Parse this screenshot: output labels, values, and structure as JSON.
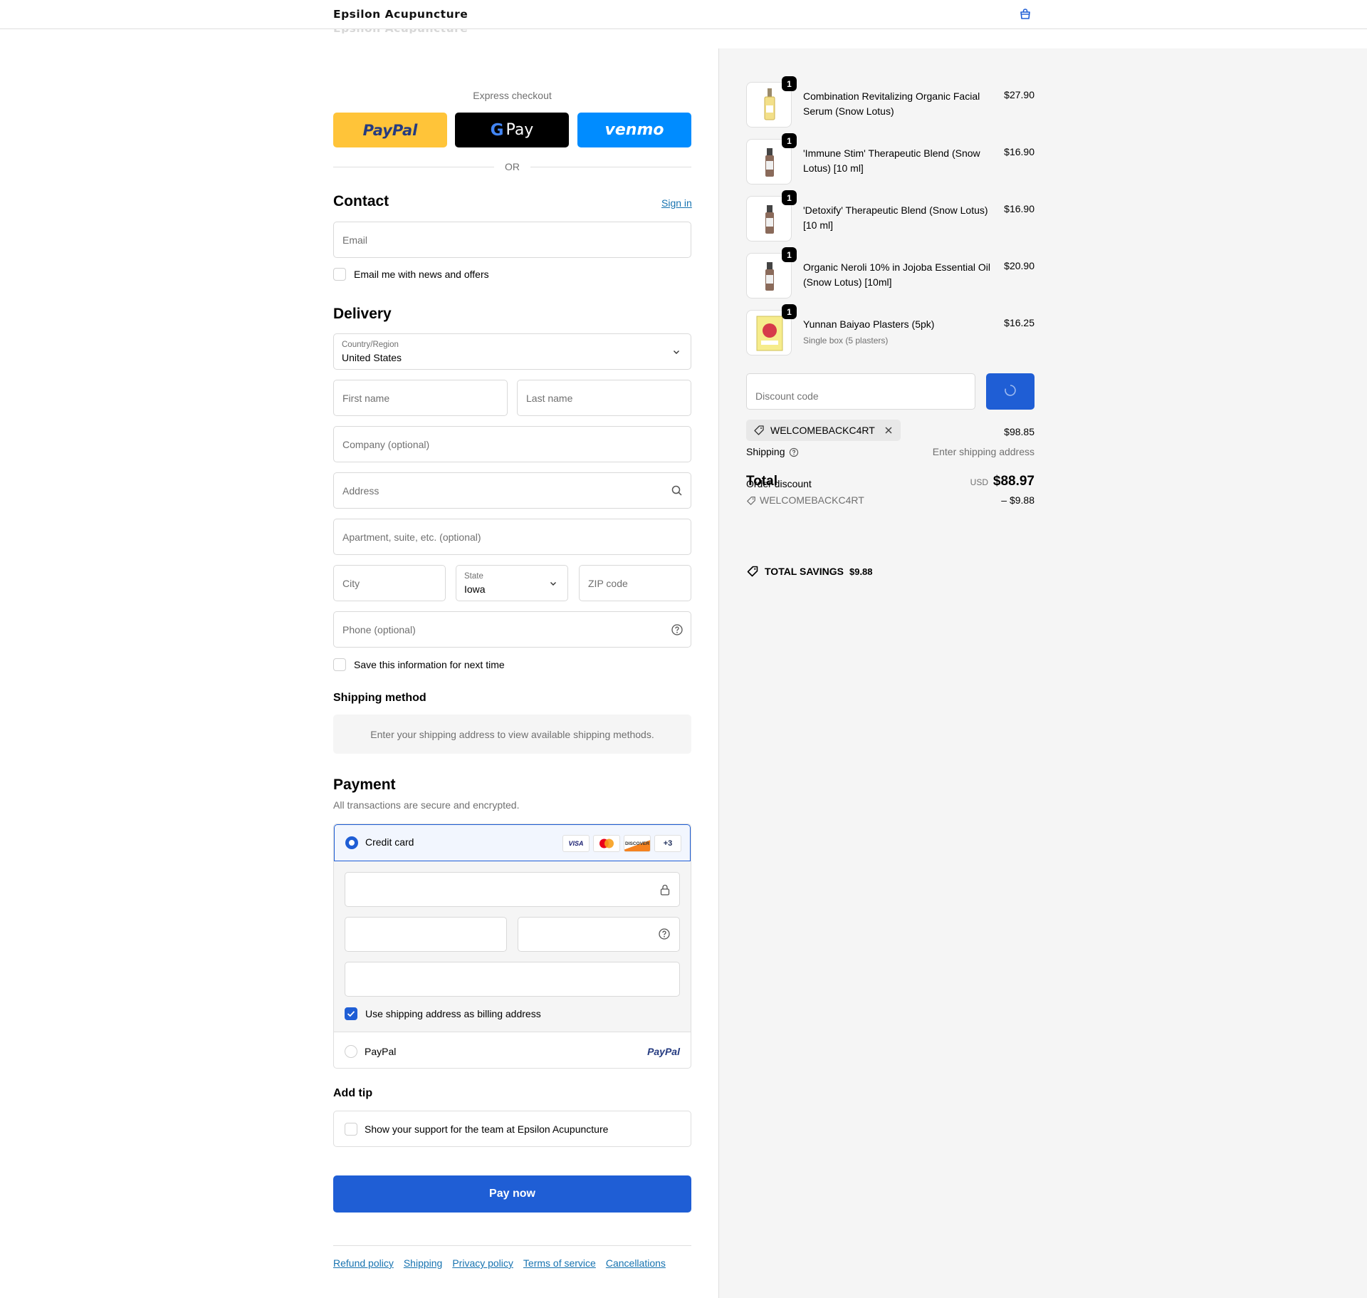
{
  "header": {
    "brand": "Epsilon Acupuncture"
  },
  "express": {
    "label": "Express checkout",
    "paypal": "PayPal",
    "gpay_g": "G",
    "gpay": "Pay",
    "venmo": "venmo",
    "or": "OR"
  },
  "contact": {
    "title": "Contact",
    "sign_in": "Sign in",
    "email_placeholder": "Email",
    "news_label": "Email me with news and offers"
  },
  "delivery": {
    "title": "Delivery",
    "country_label": "Country/Region",
    "country_value": "United States",
    "first_name": "First name",
    "last_name": "Last name",
    "company": "Company (optional)",
    "address": "Address",
    "apartment": "Apartment, suite, etc. (optional)",
    "city": "City",
    "state_label": "State",
    "state_value": "Iowa",
    "zip": "ZIP code",
    "phone": "Phone (optional)",
    "save_label": "Save this information for next time"
  },
  "shipping_method": {
    "title": "Shipping method",
    "info": "Enter your shipping address to view available shipping methods."
  },
  "payment": {
    "title": "Payment",
    "subtitle": "All transactions are secure and encrypted.",
    "credit_card": "Credit card",
    "cards": [
      "VISA",
      "",
      "DISCOVER",
      "+3"
    ],
    "billing_label": "Use shipping address as billing address",
    "paypal_label": "PayPal",
    "paypal_logo": "PayPal"
  },
  "tip": {
    "title": "Add tip",
    "label": "Show your support for the team at Epsilon Acupuncture"
  },
  "pay_now": "Pay now",
  "footer": {
    "links": [
      "Refund policy",
      "Shipping",
      "Privacy policy",
      "Terms of service",
      "Cancellations"
    ]
  },
  "order": {
    "items": [
      {
        "qty": "1",
        "name": "Combination Revitalizing Organic Facial Serum (Snow Lotus)",
        "sub": "",
        "price": "$27.90"
      },
      {
        "qty": "1",
        "name": "'Immune Stim' Therapeutic Blend (Snow Lotus) [10 ml]",
        "sub": "",
        "price": "$16.90"
      },
      {
        "qty": "1",
        "name": "'Detoxify' Therapeutic Blend (Snow Lotus) [10 ml]",
        "sub": "",
        "price": "$16.90"
      },
      {
        "qty": "1",
        "name": "Organic Neroli 10% in Jojoba Essential Oil (Snow Lotus) [10ml]",
        "sub": "",
        "price": "$20.90"
      },
      {
        "qty": "1",
        "name": "Yunnan Baiyao Plasters (5pk)",
        "sub": "Single box (5 plasters)",
        "price": "$16.25"
      }
    ],
    "discount_placeholder": "Discount code",
    "applied_code": "WELCOMEBACKC4RT",
    "subtotal": "$98.85",
    "shipping_label": "Shipping",
    "shipping_value": "Enter shipping address",
    "total_label": "Total",
    "order_discount_label": "Order discount",
    "currency": "USD",
    "total": "$88.97",
    "discount_code": "WELCOMEBACKC4RT",
    "discount_amount": "– $9.88",
    "savings_label": "TOTAL SAVINGS",
    "savings_value": "$9.88"
  },
  "colors": {
    "accent": "#1f5ed5",
    "link": "#1773b0",
    "paypal_yellow": "#ffc439",
    "venmo_blue": "#008cff"
  }
}
